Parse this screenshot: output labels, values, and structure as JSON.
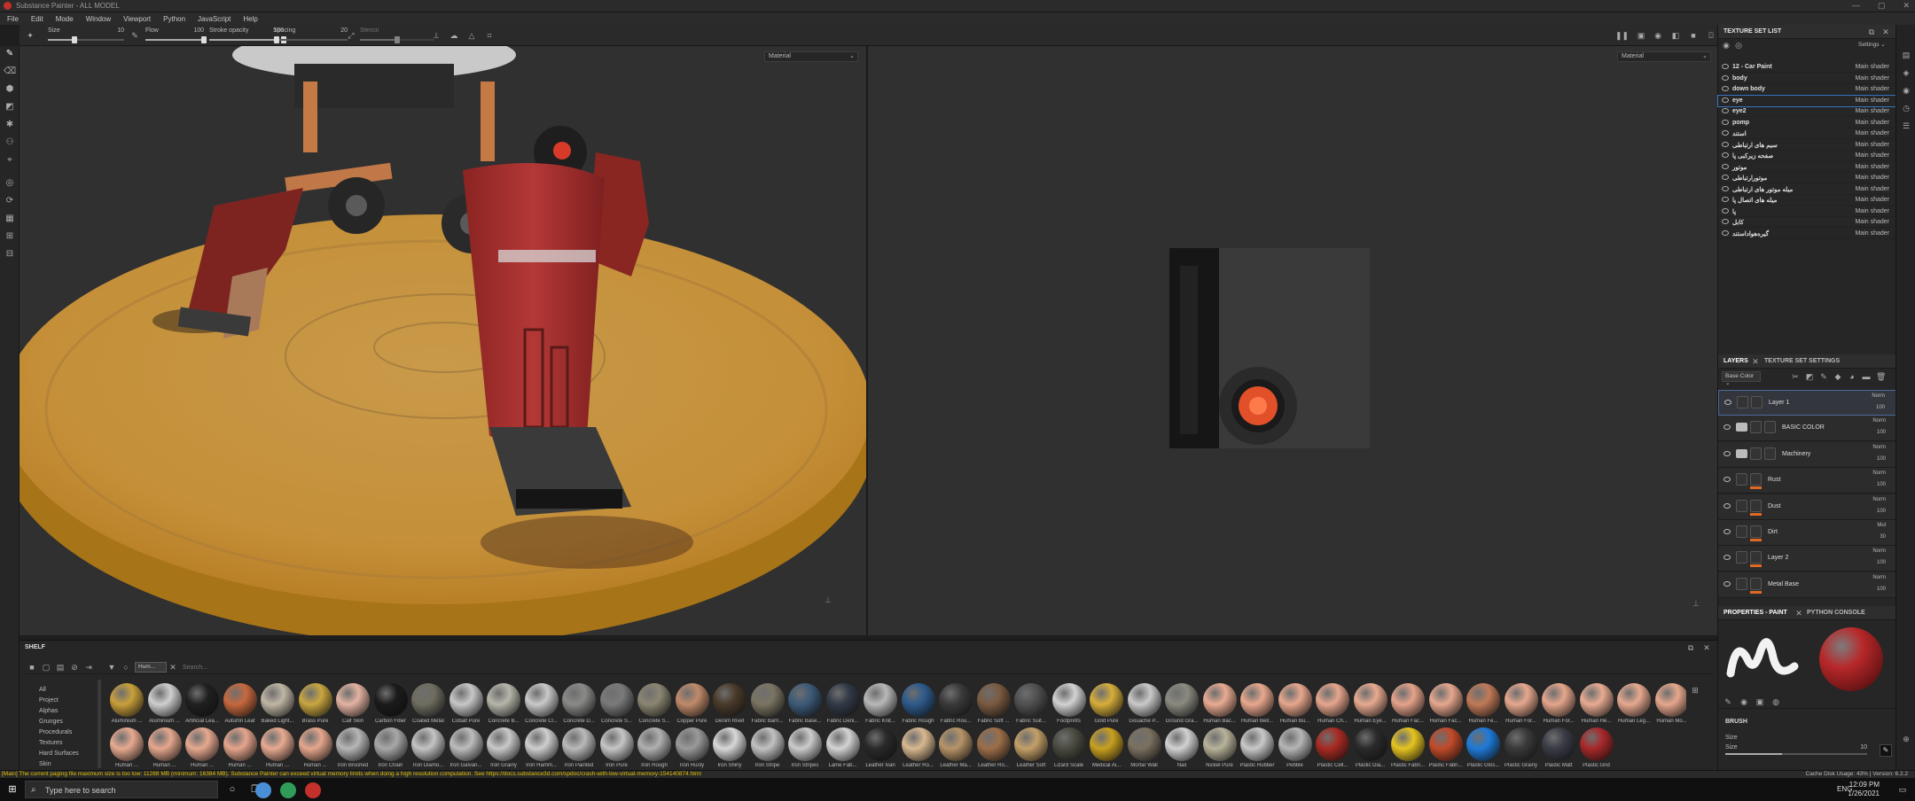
{
  "window": {
    "title": "Substance Painter - ALL MODEL",
    "controls": [
      "—",
      "▢",
      "✕"
    ]
  },
  "menu": [
    "File",
    "Edit",
    "Mode",
    "Window",
    "Viewport",
    "Python",
    "JavaScript",
    "Help"
  ],
  "toolbar": {
    "size_label": "Size",
    "size_value": "10",
    "size_level": 0.35,
    "flow_label": "Flow",
    "flow_value": "100",
    "flow_level": 1.0,
    "stroke_opacity_label": "Stroke opacity",
    "stroke_opacity_value": "100",
    "stroke_opacity_level": 1.0,
    "spacing_label": "Spacing",
    "spacing_value": "20",
    "spacing_level": 0.05,
    "stencil_label": "Stencil",
    "stencil_level": 0.5
  },
  "viewport3d": {
    "channel_select": "Material"
  },
  "viewport2d": {
    "channel_select": "Material"
  },
  "shelf": {
    "title": "SHELF",
    "search_tag": "Hum...",
    "search_placeholder": "Search...",
    "categories": [
      "All",
      "Project",
      "Alphas",
      "Grunges",
      "Procedurals",
      "Textures",
      "Hard Surfaces",
      "Skin"
    ],
    "row1": [
      {
        "label": "Aluminium ...",
        "color": "#c9a03a"
      },
      {
        "label": "Aluminium ...",
        "color": "#cfcfcf"
      },
      {
        "label": "Artificial Lea...",
        "color": "#202020"
      },
      {
        "label": "Autumn Leaf",
        "color": "#c7683e"
      },
      {
        "label": "Baked Light...",
        "color": "#bfb6a4"
      },
      {
        "label": "Brass Pure",
        "color": "#c9a640"
      },
      {
        "label": "Calf Skin",
        "color": "#e3b3a2"
      },
      {
        "label": "Carbon Fiber",
        "color": "#1b1b1b"
      },
      {
        "label": "Coated Metal",
        "color": "#6f6d60"
      },
      {
        "label": "Cobalt Pure",
        "color": "#c7c7c7"
      },
      {
        "label": "Concrete B...",
        "color": "#b7b6aa"
      },
      {
        "label": "Concrete Cl...",
        "color": "#c9c9c9"
      },
      {
        "label": "Concrete D...",
        "color": "#8a8a88"
      },
      {
        "label": "Concrete S...",
        "color": "#7a7a7a"
      },
      {
        "label": "Concrete S...",
        "color": "#8b8672"
      },
      {
        "label": "Copper Pure",
        "color": "#c08a6a"
      },
      {
        "label": "Denim Rivet",
        "color": "#4a3a2a"
      },
      {
        "label": "Fabric Barn...",
        "color": "#7a7462"
      },
      {
        "label": "Fabric Base...",
        "color": "#3c5a78"
      },
      {
        "label": "Fabric Deni...",
        "color": "#323a48"
      },
      {
        "label": "Fabric Knit...",
        "color": "#b8b8b8"
      },
      {
        "label": "Fabric Rough",
        "color": "#2d5a8c"
      },
      {
        "label": "Fabric Rou...",
        "color": "#3a3a3a"
      },
      {
        "label": "Fabric Soft ...",
        "color": "#7a5a40"
      },
      {
        "label": "Fabric Suit...",
        "color": "#505050"
      },
      {
        "label": "Footprints",
        "color": "#d2d2d2"
      },
      {
        "label": "Gold Pure",
        "color": "#d6ae3a"
      },
      {
        "label": "Gouache P...",
        "color": "#c9c9c9"
      },
      {
        "label": "Ground Gra...",
        "color": "#8a8a80"
      },
      {
        "label": "Human Bac...",
        "color": "#e9ab92"
      },
      {
        "label": "Human Bell...",
        "color": "#e8a88e"
      },
      {
        "label": "Human Bu...",
        "color": "#e7a78d"
      },
      {
        "label": "Human Ch...",
        "color": "#e6a68d"
      },
      {
        "label": "Human Eye...",
        "color": "#e8aa90"
      },
      {
        "label": "Human Fac...",
        "color": "#e5a38a"
      },
      {
        "label": "Human Fac...",
        "color": "#e7a78e"
      },
      {
        "label": "Human Fe...",
        "color": "#c07a58"
      },
      {
        "label": "Human For...",
        "color": "#e6a88e"
      },
      {
        "label": "Human For...",
        "color": "#e5a68c"
      },
      {
        "label": "Human He...",
        "color": "#e8ab92"
      },
      {
        "label": "Human Leg...",
        "color": "#e7a98f"
      },
      {
        "label": "Human Mo...",
        "color": "#e6a78d"
      }
    ],
    "row2": [
      {
        "label": "Human ...",
        "color": "#e8aa91"
      },
      {
        "label": "Human ...",
        "color": "#e6a78e"
      },
      {
        "label": "Human ...",
        "color": "#e7a990"
      },
      {
        "label": "Human ...",
        "color": "#e5a58c"
      },
      {
        "label": "Human ...",
        "color": "#e8aa91"
      },
      {
        "label": "Human ...",
        "color": "#e6a78d"
      },
      {
        "label": "Iron Brushed",
        "color": "#b6b6b6"
      },
      {
        "label": "Iron Chain",
        "color": "#a8a8a8"
      },
      {
        "label": "Iron Diamo...",
        "color": "#c4c4c4"
      },
      {
        "label": "Iron Galvan...",
        "color": "#bdbdbd"
      },
      {
        "label": "Iron Grainy",
        "color": "#c9c9c9"
      },
      {
        "label": "Iron Hamm...",
        "color": "#cfcfcf"
      },
      {
        "label": "Iron Painted",
        "color": "#bababa"
      },
      {
        "label": "Iron Pure",
        "color": "#c6c6c6"
      },
      {
        "label": "Iron Rough",
        "color": "#b0b0b0"
      },
      {
        "label": "Iron Rusty",
        "color": "#9a9a9a"
      },
      {
        "label": "Iron Shiny",
        "color": "#d8d8d8"
      },
      {
        "label": "Iron Stripe",
        "color": "#c2c2c2"
      },
      {
        "label": "Iron Stripes",
        "color": "#cccccc"
      },
      {
        "label": "Lame Fab...",
        "color": "#d4d4d4"
      },
      {
        "label": "Leather Ivan",
        "color": "#2a2a2a"
      },
      {
        "label": "Leather Ro...",
        "color": "#d8b890"
      },
      {
        "label": "Leather Ma...",
        "color": "#b79468"
      },
      {
        "label": "Leather Ro...",
        "color": "#9c6e48"
      },
      {
        "label": "Leather Soft",
        "color": "#c4a068"
      },
      {
        "label": "Lizard Scale",
        "color": "#4a4a40"
      },
      {
        "label": "Medical Ai...",
        "color": "#c9a020"
      },
      {
        "label": "Mortar Wall",
        "color": "#7a7060"
      },
      {
        "label": "Nail",
        "color": "#d2d2d2"
      },
      {
        "label": "Nickel Pure",
        "color": "#b9b39a"
      },
      {
        "label": "Plastic Rubber",
        "color": "#c9c9c9"
      },
      {
        "label": "Pebble",
        "color": "#b6b6b6"
      },
      {
        "label": "Plastic Cell...",
        "color": "#a82a22"
      },
      {
        "label": "Plastic Dia...",
        "color": "#2a2a2a"
      },
      {
        "label": "Plastic Fabri...",
        "color": "#e6c420"
      },
      {
        "label": "Plastic Fabri...",
        "color": "#c24a2a"
      },
      {
        "label": "Plastic Glos...",
        "color": "#1e7ad8"
      },
      {
        "label": "Plastic Grainy",
        "color": "#3a3a3a"
      },
      {
        "label": "Plastic Matt",
        "color": "#3a3c46"
      },
      {
        "label": "Plastic Grid",
        "color": "#a8282a"
      }
    ]
  },
  "texture_set_list": {
    "title": "TEXTURE SET LIST",
    "settings_label": "Settings",
    "items": [
      {
        "name": "12 - Car Paint",
        "shader": "Main shader"
      },
      {
        "name": "body",
        "shader": "Main shader"
      },
      {
        "name": "down body",
        "shader": "Main shader"
      },
      {
        "name": "eye",
        "shader": "Main shader"
      },
      {
        "name": "eye2",
        "shader": "Main shader"
      },
      {
        "name": "pomp",
        "shader": "Main shader"
      },
      {
        "name": "استند",
        "shader": "Main shader"
      },
      {
        "name": "سیم های ارتباطی",
        "shader": "Main shader"
      },
      {
        "name": "صفحه زیرکبی پا",
        "shader": "Main shader"
      },
      {
        "name": "موتور",
        "shader": "Main shader"
      },
      {
        "name": "موتورارتباطی",
        "shader": "Main shader"
      },
      {
        "name": "میله موتور های ارتباطی",
        "shader": "Main shader"
      },
      {
        "name": "میله های اتصال پا",
        "shader": "Main shader"
      },
      {
        "name": "پا",
        "shader": "Main shader"
      },
      {
        "name": "کابل",
        "shader": "Main shader"
      },
      {
        "name": "گیره‌هواداستند",
        "shader": "Main shader"
      }
    ]
  },
  "layers": {
    "tab_layers": "LAYERS",
    "tab_settings": "TEXTURE SET SETTINGS",
    "channel": "Base Color",
    "items": [
      {
        "name": "Layer 1",
        "blend": "Norm",
        "opacity": "100",
        "type": "fill",
        "mask": false
      },
      {
        "name": "BASIC COLOR",
        "blend": "Norm",
        "opacity": "100",
        "type": "folder",
        "mask": false
      },
      {
        "name": "Machinery",
        "blend": "Norm",
        "opacity": "100",
        "type": "folder",
        "mask": false
      },
      {
        "name": "Rust",
        "blend": "Norm",
        "opacity": "100",
        "type": "fill",
        "mask": true
      },
      {
        "name": "Dust",
        "blend": "Norm",
        "opacity": "100",
        "type": "fill",
        "mask": true
      },
      {
        "name": "Dirt",
        "blend": "Mul",
        "opacity": "30",
        "type": "fill",
        "mask": true
      },
      {
        "name": "Layer 2",
        "blend": "Norm",
        "opacity": "100",
        "type": "fill",
        "mask": true
      },
      {
        "name": "Metal Base",
        "blend": "Norm",
        "opacity": "100",
        "type": "fill",
        "mask": true
      }
    ]
  },
  "properties": {
    "tab_paint": "PROPERTIES - PAINT",
    "tab_python": "PYTHON CONSOLE",
    "brush_label": "BRUSH",
    "size_label": "Size",
    "size_value": "10",
    "material_color": "#b8282a"
  },
  "status": {
    "message": "[Main] The current paging file maximum size is too low: 11288 MB (minimum: 16384 MB). Substance Painter can exceed virtual memory limits when doing a high resolution computation. See https://docs.substance3d.com/spdoc/crash-with-low-virtual-memory-154140874.html",
    "cache": "Cache Disk Usage:   43% | Version: 6.2.2"
  },
  "taskbar": {
    "search_placeholder": "Type here to search",
    "lang": "ENG",
    "time": "12:09 PM",
    "date": "1/26/2021"
  },
  "colors": {
    "accent": "#e06a24",
    "highlight": "#3a74c4",
    "bg": "#262626"
  }
}
